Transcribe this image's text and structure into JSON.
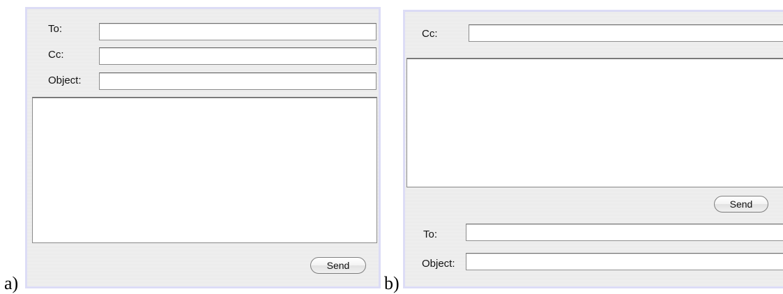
{
  "panel_a": {
    "label": "a)",
    "to_label": "To:",
    "to_value": "",
    "cc_label": "Cc:",
    "cc_value": "",
    "object_label": "Object:",
    "object_value": "",
    "body_value": "",
    "send_label": "Send"
  },
  "panel_b": {
    "label": "b)",
    "cc_label": "Cc:",
    "cc_value": "",
    "body_value": "",
    "send_label": "Send",
    "to_label": "To:",
    "to_value": "",
    "object_label": "Object:",
    "object_value": ""
  }
}
